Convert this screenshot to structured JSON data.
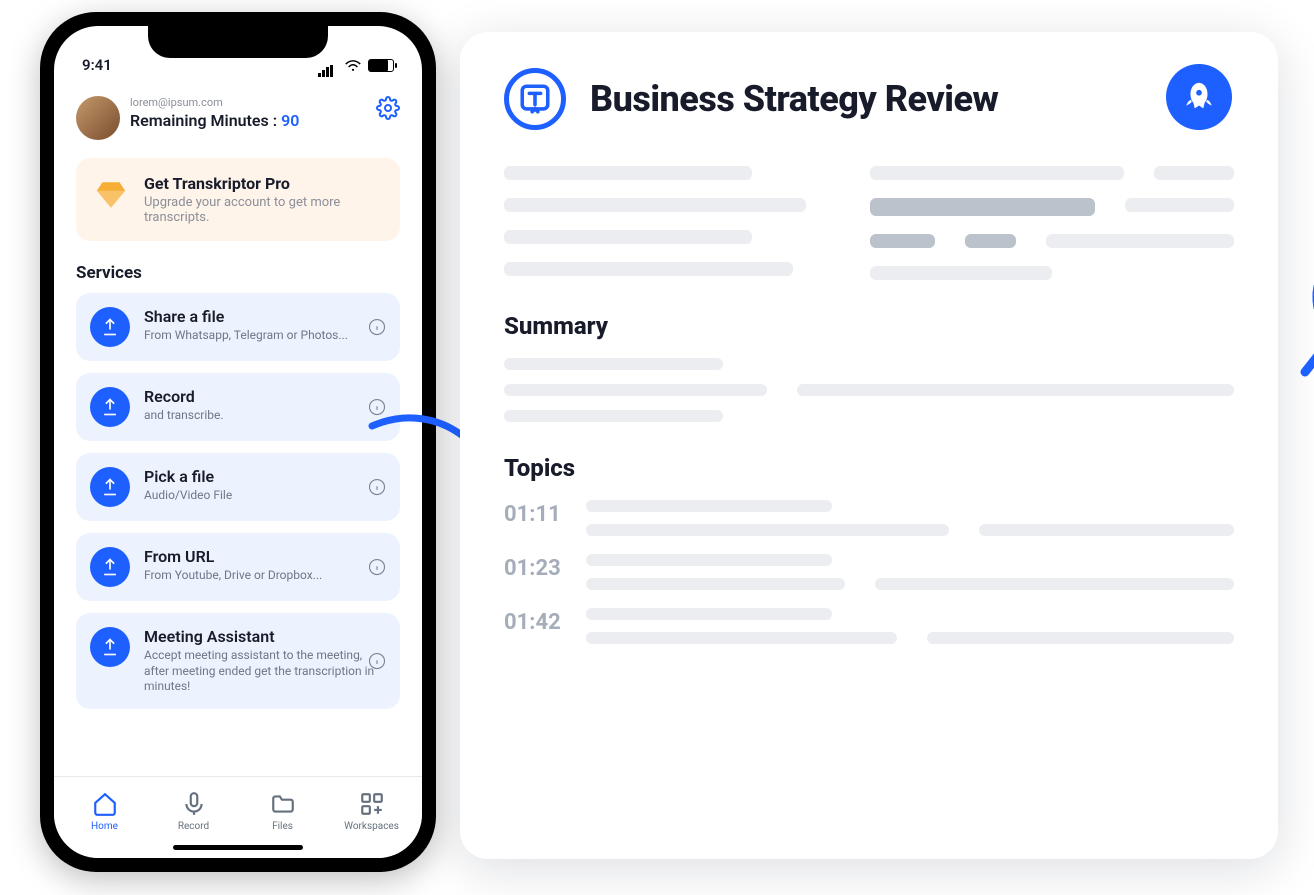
{
  "phone": {
    "status_time": "9:41",
    "user": {
      "email": "lorem@ipsum.com",
      "minutes_label": "Remaining Minutes :",
      "minutes_value": "90"
    },
    "promo": {
      "title": "Get Transkriptor Pro",
      "subtitle": "Upgrade your account to get more transcripts."
    },
    "services_heading": "Services",
    "services": [
      {
        "title": "Share a file",
        "subtitle": "From Whatsapp, Telegram or Photos..."
      },
      {
        "title": "Record",
        "subtitle": "and transcribe."
      },
      {
        "title": "Pick a file",
        "subtitle": "Audio/Video File"
      },
      {
        "title": "From URL",
        "subtitle": "From Youtube, Drive or Dropbox..."
      },
      {
        "title": "Meeting Assistant",
        "subtitle": "Accept meeting assistant to the meeting, after meeting ended get the transcription in minutes!"
      }
    ],
    "tabs": [
      {
        "label": "Home"
      },
      {
        "label": "Record"
      },
      {
        "label": "Files"
      },
      {
        "label": "Workspaces"
      }
    ]
  },
  "panel": {
    "title": "Business Strategy Review",
    "summary_heading": "Summary",
    "topics_heading": "Topics",
    "topics": [
      {
        "timestamp": "01:11"
      },
      {
        "timestamp": "01:23"
      },
      {
        "timestamp": "01:42"
      }
    ]
  }
}
